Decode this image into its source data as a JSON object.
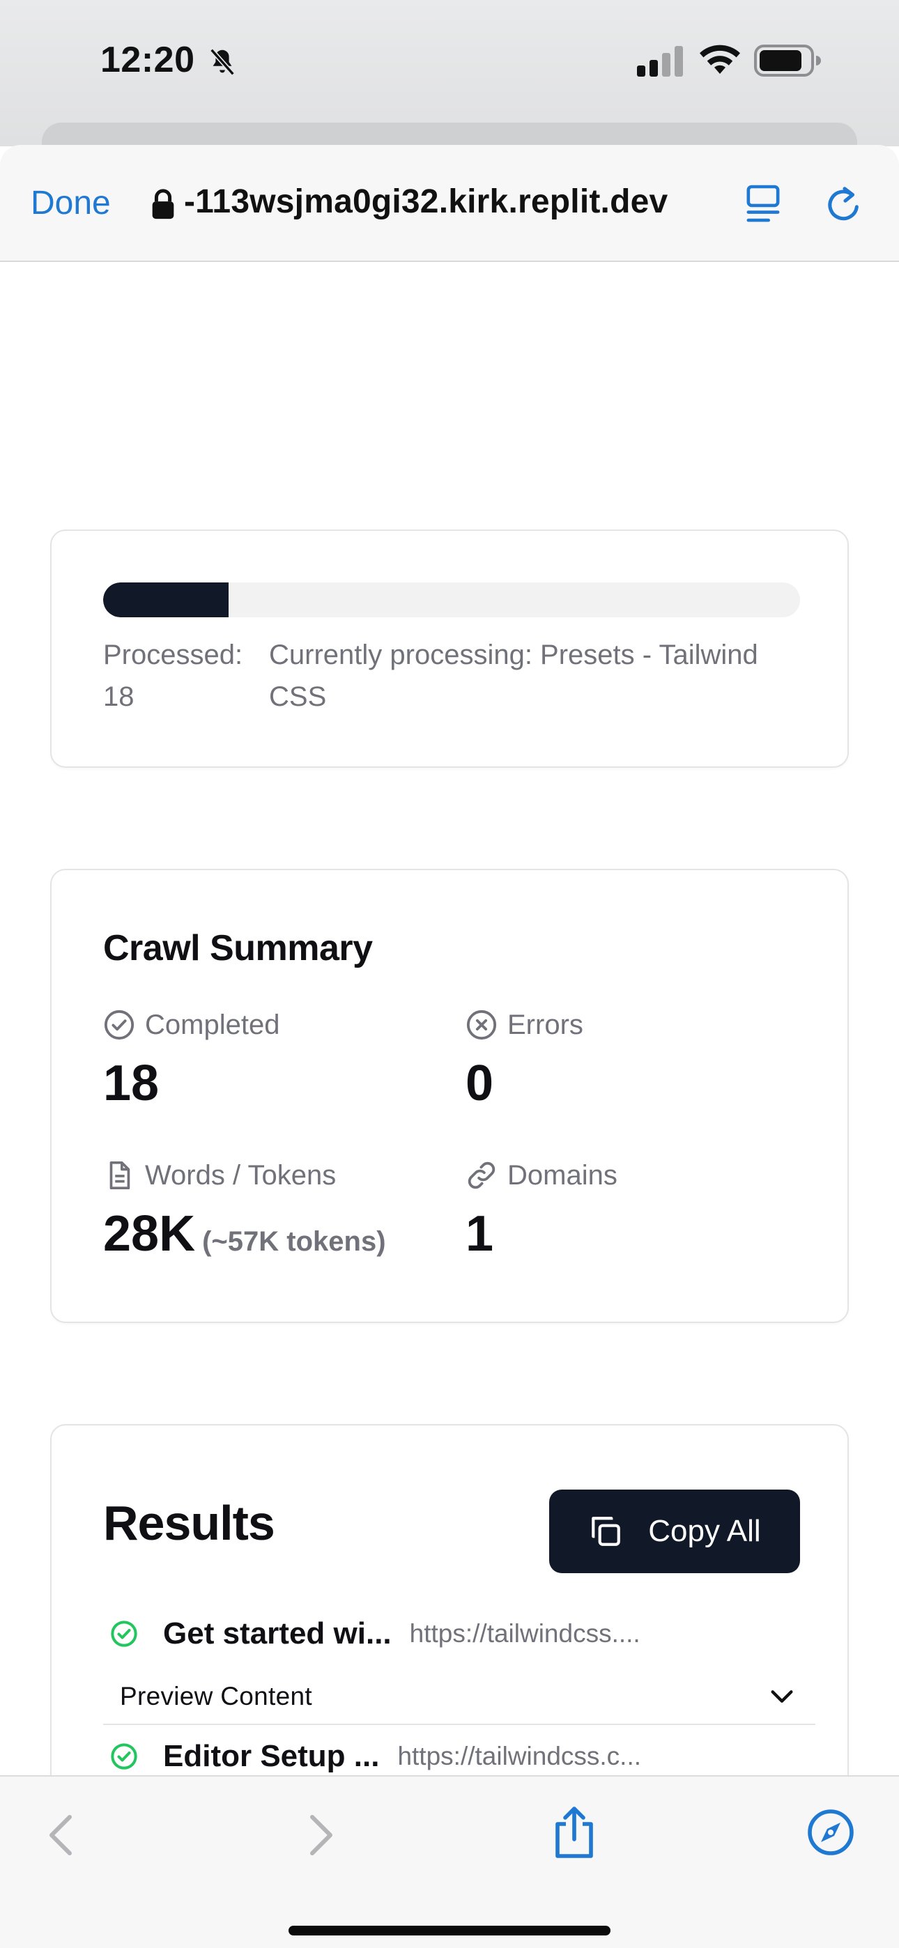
{
  "status_bar": {
    "time": "12:20",
    "icons": [
      "bell-slash-icon",
      "cellular-signal-icon",
      "wifi-icon",
      "battery-icon"
    ]
  },
  "browser": {
    "done_label": "Done",
    "url": "-113wsjma0gi32.kirk.replit.dev",
    "accent_color": "#1f78d1"
  },
  "progress": {
    "fraction": 0.18,
    "processed_label": "Processed: 18",
    "current_label": "Currently processing: Presets - Tailwind CSS"
  },
  "summary": {
    "title": "Crawl Summary",
    "completed": {
      "label": "Completed",
      "value": "18",
      "icon": "check-circle-icon"
    },
    "errors": {
      "label": "Errors",
      "value": "0",
      "icon": "x-circle-icon"
    },
    "words": {
      "label": "Words / Tokens",
      "value": "28K",
      "sub": "(~57K tokens)",
      "icon": "file-text-icon"
    },
    "domains": {
      "label": "Domains",
      "value": "1",
      "icon": "link-icon"
    }
  },
  "results": {
    "title": "Results",
    "copy_all_label": "Copy All",
    "items": [
      {
        "title": "Get started wi...",
        "url": "https://tailwindcss...."
      },
      {
        "title": "Editor Setup ...",
        "url": "https://tailwindcss.c..."
      }
    ],
    "preview_label": "Preview Content",
    "status_color": "#22c55e"
  },
  "colors": {
    "primary_dark": "#111827",
    "muted_text": "#71717a",
    "border": "#e4e4e7"
  }
}
